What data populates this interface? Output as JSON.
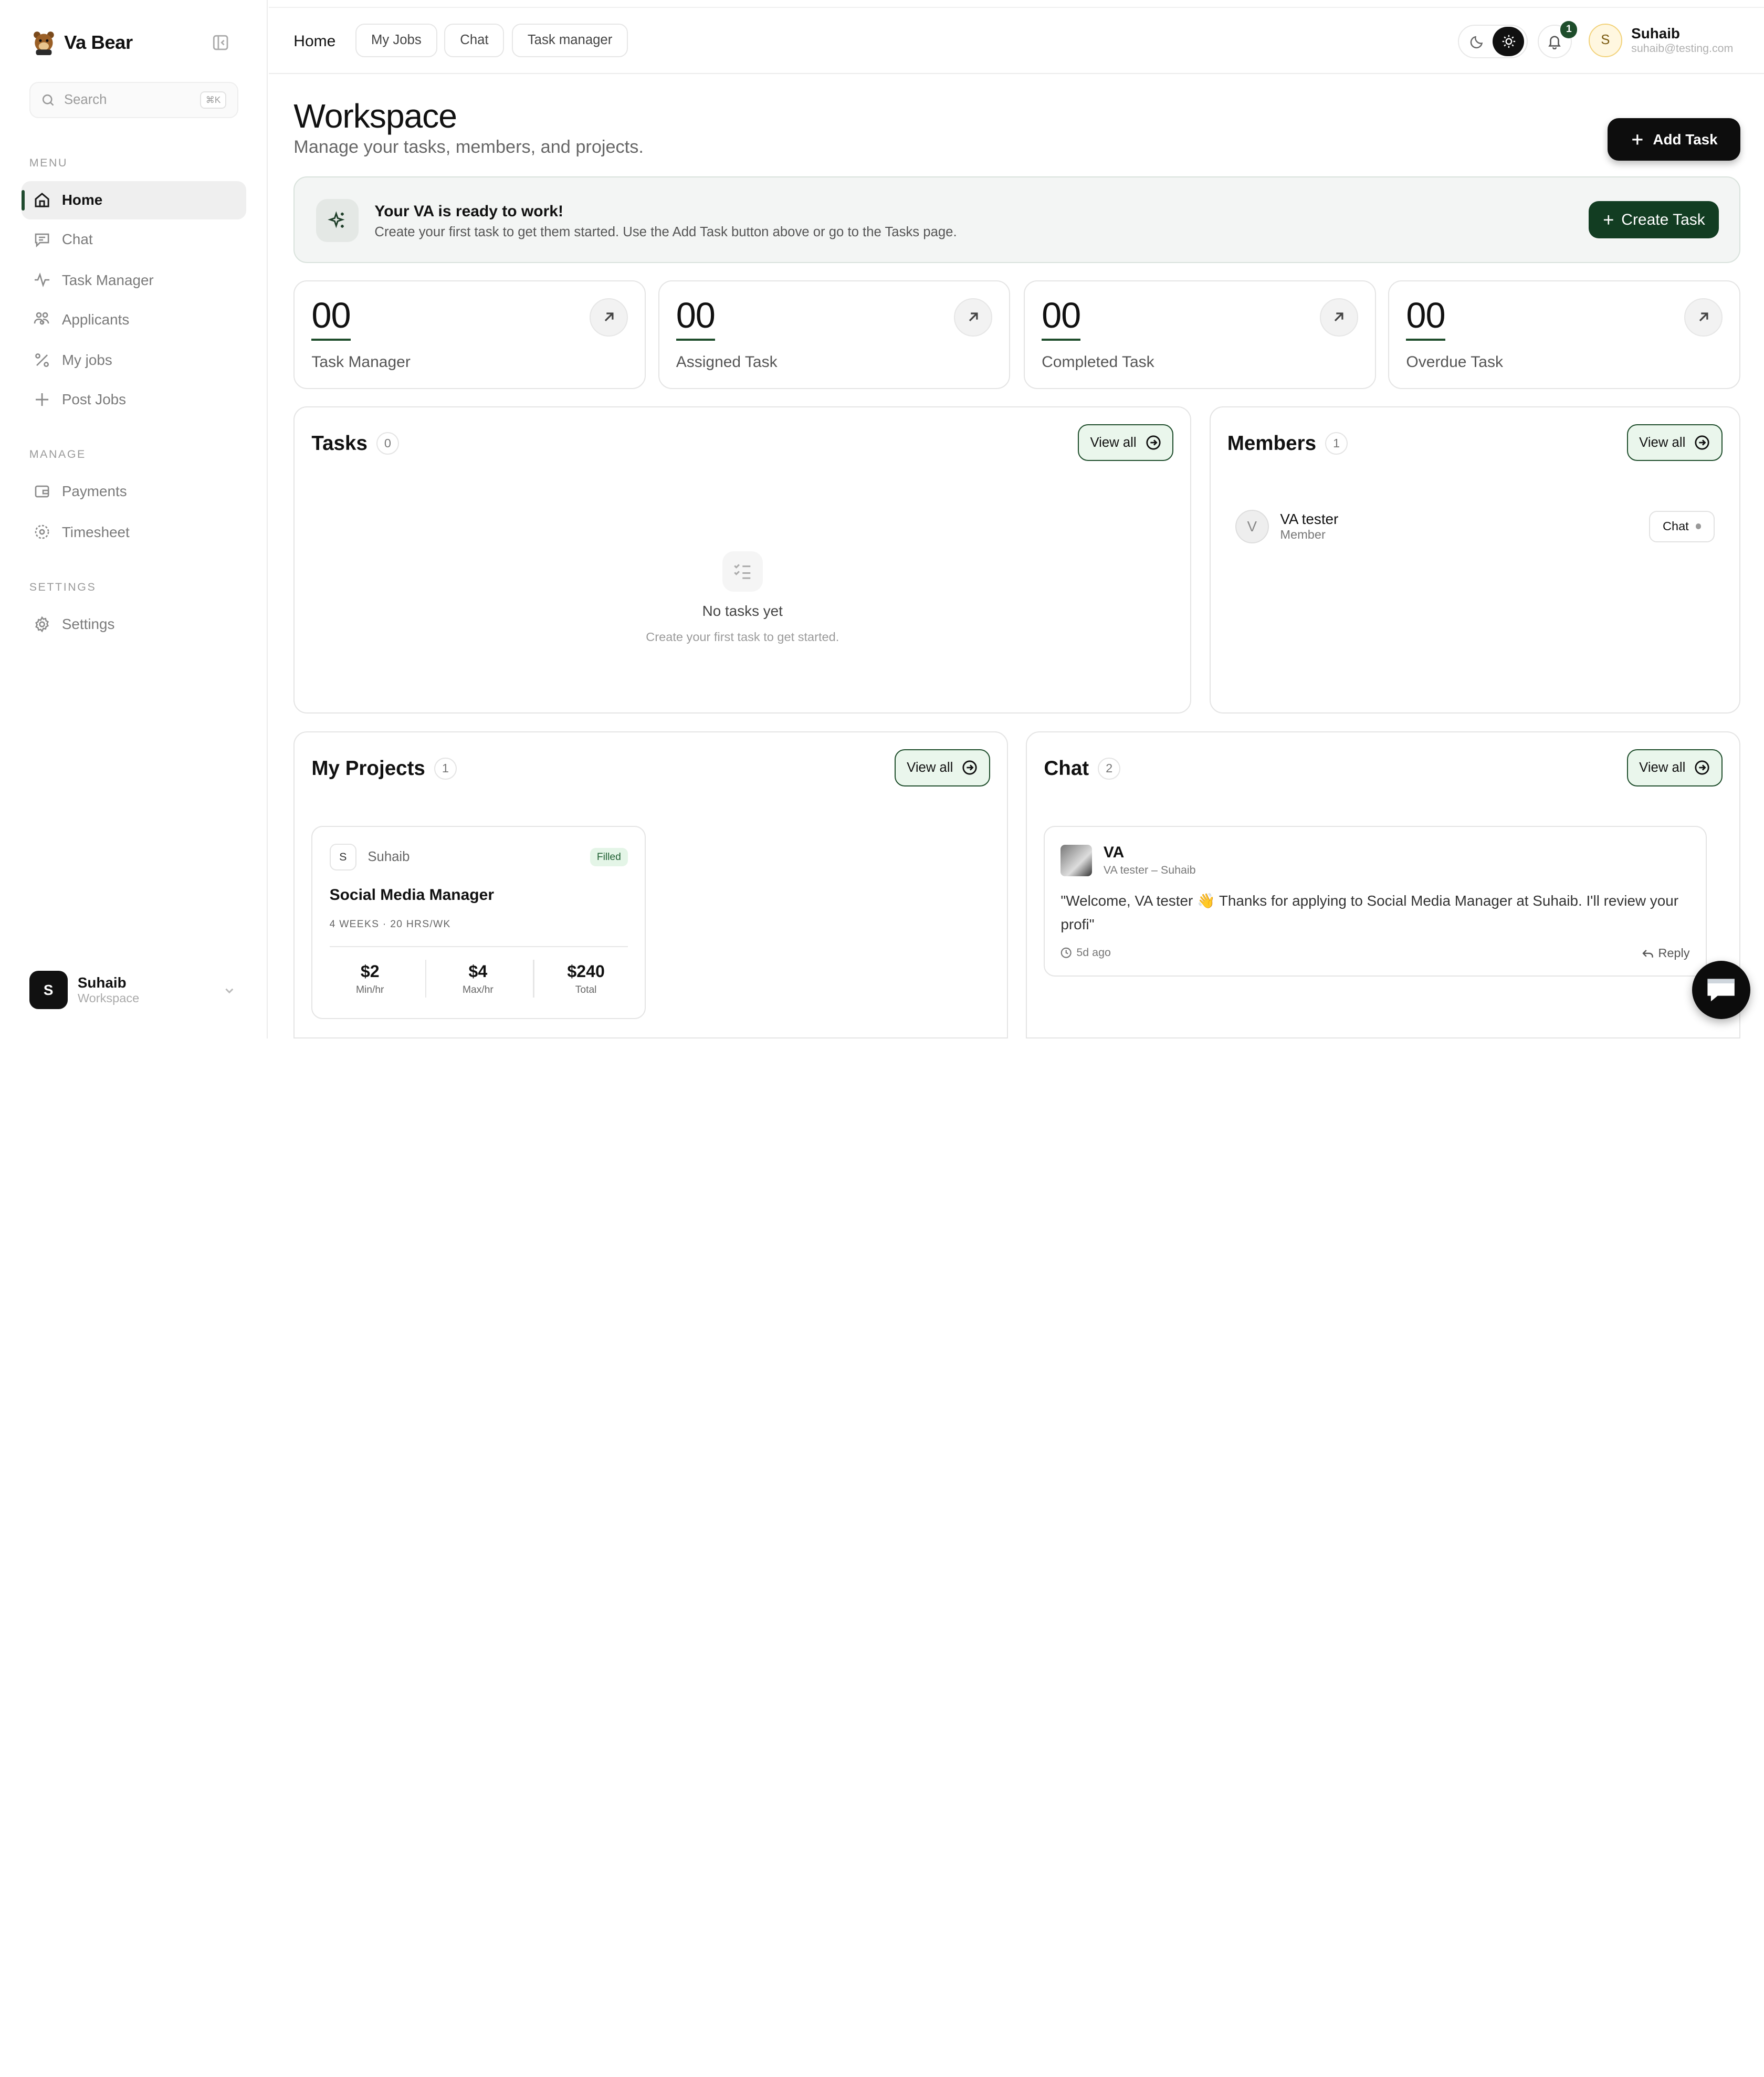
{
  "brand": {
    "name": "Va Bear",
    "logo_icon": "bear-icon"
  },
  "search": {
    "placeholder": "Search",
    "shortcut": "⌘K"
  },
  "sidebar": {
    "sections": {
      "menu": "MENU",
      "manage": "MANAGE",
      "settings": "SETTINGS"
    },
    "items": [
      {
        "label": "Home",
        "icon": "home-icon",
        "active": true
      },
      {
        "label": "Chat",
        "icon": "chat-icon"
      },
      {
        "label": "Task Manager",
        "icon": "activity-icon"
      },
      {
        "label": "Applicants",
        "icon": "users-icon"
      },
      {
        "label": "My jobs",
        "icon": "percent-icon"
      },
      {
        "label": "Post Jobs",
        "icon": "plus-icon"
      },
      {
        "label": "Payments",
        "icon": "wallet-icon"
      },
      {
        "label": "Timesheet",
        "icon": "timesheet-icon"
      },
      {
        "label": "Settings",
        "icon": "gear-icon"
      }
    ],
    "user": {
      "initial": "S",
      "name": "Suhaib",
      "sub": "Workspace"
    }
  },
  "topbar": {
    "home": "Home",
    "pills": [
      "My Jobs",
      "Chat",
      "Task manager"
    ],
    "notifications": "1",
    "user": {
      "initial": "S",
      "name": "Suhaib",
      "email": "suhaib@testing.com"
    }
  },
  "page": {
    "title": "Workspace",
    "subtitle": "Manage your tasks, members, and projects.",
    "add_task": "Add Task"
  },
  "banner": {
    "title": "Your VA is ready to work!",
    "text": "Create your first task to get them started. Use the Add Task button above or go to the Tasks page.",
    "button": "Create Task"
  },
  "stats": [
    {
      "value": "00",
      "label": "Task Manager"
    },
    {
      "value": "00",
      "label": "Assigned Task"
    },
    {
      "value": "00",
      "label": "Completed Task"
    },
    {
      "value": "00",
      "label": "Overdue Task"
    }
  ],
  "tasks": {
    "title": "Tasks",
    "count": "0",
    "view_all": "View all",
    "empty_title": "No tasks yet",
    "empty_sub": "Create your first task to get started."
  },
  "members": {
    "title": "Members",
    "count": "1",
    "view_all": "View all",
    "list": [
      {
        "initial": "V",
        "name": "VA tester",
        "role": "Member",
        "action": "Chat"
      }
    ]
  },
  "projects": {
    "title": "My Projects",
    "count": "1",
    "view_all": "View all",
    "list": [
      {
        "initial": "S",
        "owner": "Suhaib",
        "status": "Filled",
        "title": "Social Media Manager",
        "meta": "4 WEEKS · 20 HRS/WK",
        "rates": [
          {
            "value": "$2",
            "label": "Min/hr"
          },
          {
            "value": "$4",
            "label": "Max/hr"
          },
          {
            "value": "$240",
            "label": "Total"
          }
        ]
      }
    ]
  },
  "chat": {
    "title": "Chat",
    "count": "2",
    "view_all": "View all",
    "messages": [
      {
        "name": "VA",
        "sub": "VA tester – Suhaib",
        "text": "\"Welcome, VA tester 👋 Thanks for applying to Social Media Manager at Suhaib. I'll review your profi\"",
        "time": "5d ago",
        "reply": "Reply"
      }
    ]
  },
  "colors": {
    "accent": "#1e4d2b",
    "dark": "#0d0d0d",
    "highlight": "#eaf6ec"
  }
}
